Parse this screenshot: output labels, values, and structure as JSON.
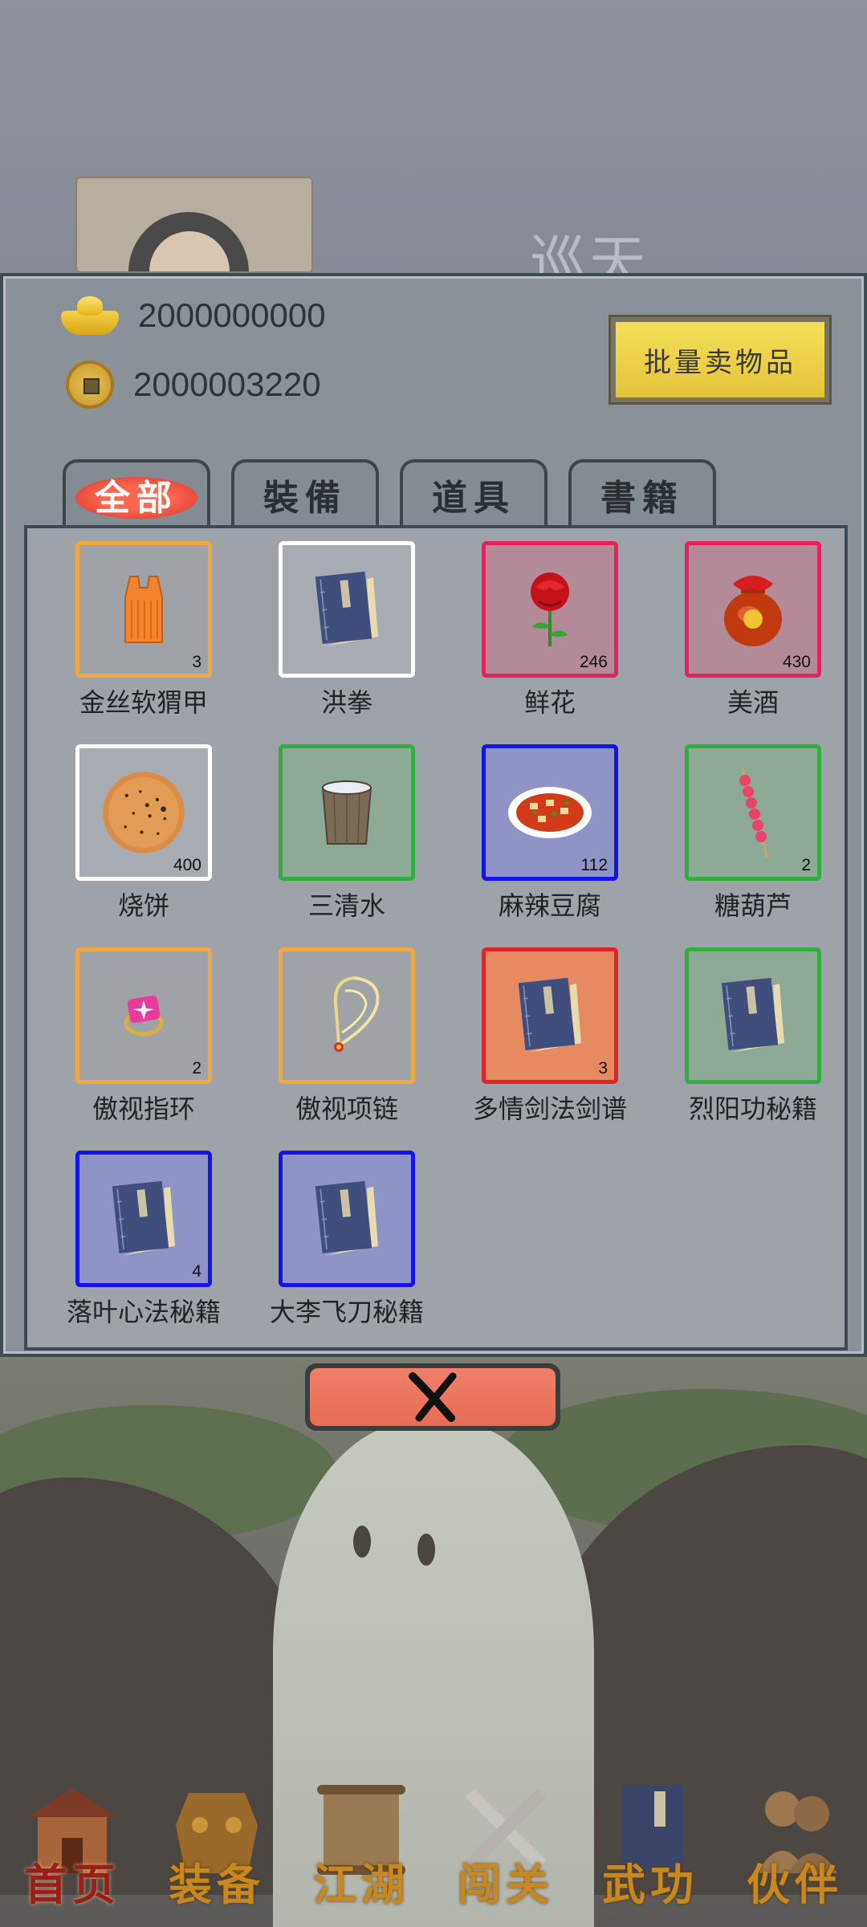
{
  "scene": {
    "name": "巡天"
  },
  "currencies": {
    "gold_ingot": {
      "icon": "gold-ingot-icon",
      "value": "2000000000"
    },
    "copper_coin": {
      "icon": "copper-coin-icon",
      "value": "2000003220"
    }
  },
  "bulk_sell_label": "批量卖物品",
  "tabs": [
    {
      "label": "全部",
      "active": true
    },
    {
      "label": "裝備",
      "active": false
    },
    {
      "label": "道具",
      "active": false
    },
    {
      "label": "書籍",
      "active": false
    }
  ],
  "items": [
    {
      "name": "金丝软猬甲",
      "count": "3",
      "quality": "orange",
      "icon": "armor-vest-icon"
    },
    {
      "name": "洪拳",
      "count": "",
      "quality": "white",
      "icon": "book-icon"
    },
    {
      "name": "鲜花",
      "count": "246",
      "quality": "red",
      "icon": "rose-icon"
    },
    {
      "name": "美酒",
      "count": "430",
      "quality": "red",
      "icon": "wine-jar-icon"
    },
    {
      "name": "烧饼",
      "count": "400",
      "quality": "white",
      "icon": "flatbread-icon"
    },
    {
      "name": "三清水",
      "count": "",
      "quality": "green",
      "icon": "water-bucket-icon"
    },
    {
      "name": "麻辣豆腐",
      "count": "112",
      "quality": "blue",
      "icon": "tofu-dish-icon"
    },
    {
      "name": "糖葫芦",
      "count": "2",
      "quality": "green",
      "icon": "candied-haws-icon"
    },
    {
      "name": "傲视指环",
      "count": "2",
      "quality": "orange",
      "icon": "ring-icon"
    },
    {
      "name": "傲视项链",
      "count": "",
      "quality": "orange",
      "icon": "necklace-icon"
    },
    {
      "name": "多情剑法剑谱",
      "count": "3",
      "quality": "redorange",
      "icon": "book-icon"
    },
    {
      "name": "烈阳功秘籍",
      "count": "",
      "quality": "green",
      "icon": "book-icon"
    },
    {
      "name": "落叶心法秘籍",
      "count": "4",
      "quality": "blue",
      "icon": "book-icon"
    },
    {
      "name": "大李飞刀秘籍",
      "count": "",
      "quality": "blue",
      "icon": "book-icon"
    }
  ],
  "close_button": {
    "icon": "close-icon"
  },
  "nav": [
    {
      "label": "首页",
      "icon": "house-icon",
      "active": true
    },
    {
      "label": "装备",
      "icon": "armor-icon",
      "active": false
    },
    {
      "label": "江湖",
      "icon": "scroll-icon",
      "active": false
    },
    {
      "label": "闯关",
      "icon": "swords-icon",
      "active": false
    },
    {
      "label": "武功",
      "icon": "book-icon",
      "active": false
    },
    {
      "label": "伙伴",
      "icon": "partners-icon",
      "active": false
    }
  ],
  "colors": {
    "quality_orange": "#f0a840",
    "quality_white": "#ffffff",
    "quality_red": "#e0245e",
    "quality_green": "#2fae3c",
    "quality_blue": "#1414e8",
    "quality_redorange": "#e0242a",
    "nav_label": "#c7891f",
    "nav_label_active": "#9a1f17"
  }
}
